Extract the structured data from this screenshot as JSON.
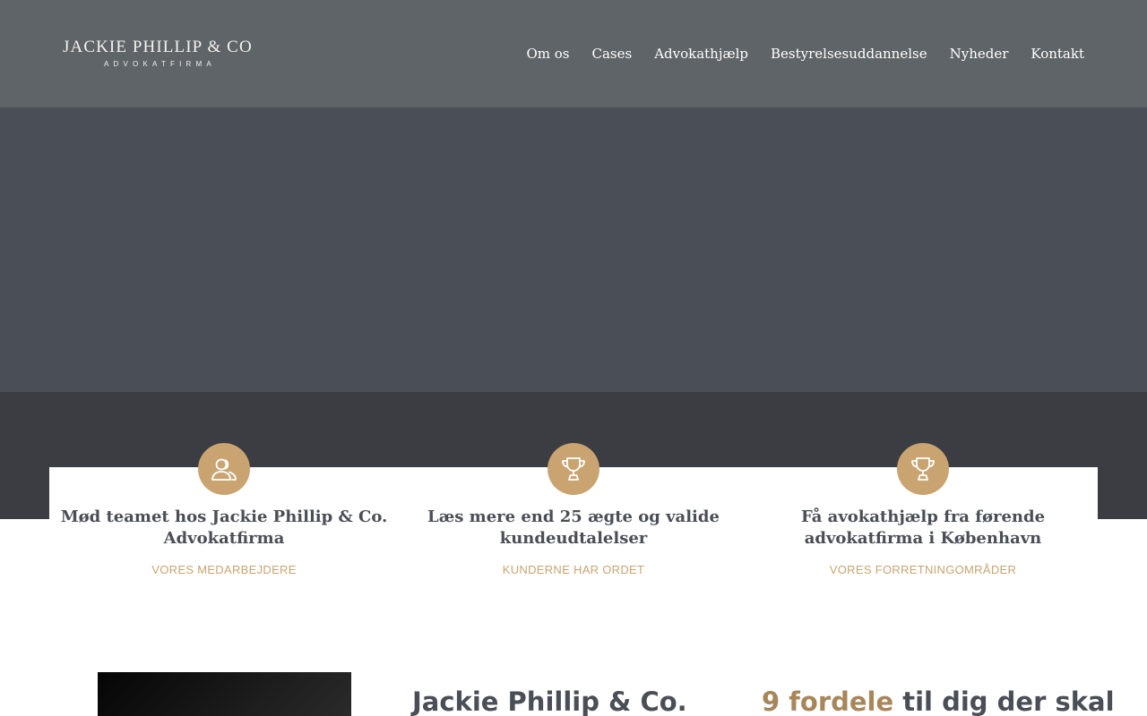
{
  "header": {
    "logo_name": "JACKIE PHILLIP & CO",
    "logo_sub": "ADVOKATFIRMA",
    "nav": [
      "Om os",
      "Cases",
      "Advokathjælp",
      "Bestyrelsesuddannelse",
      "Nyheder",
      "Kontakt"
    ]
  },
  "features": [
    {
      "icon": "people-icon",
      "title": "Mød teamet hos Jackie Phillip & Co. Advokatfirma",
      "link": "VORES MEDARBEJDERE"
    },
    {
      "icon": "trophy-icon",
      "title": "Læs mere end 25 ægte og valide kundeudtalelser",
      "link": "KUNDERNE HAR ORDET"
    },
    {
      "icon": "trophy-icon",
      "title": "Få avokathjælp fra førende advokatfirma i København",
      "link": "VORES FORRETNINGOMRÅDER"
    }
  ],
  "bottom": {
    "heading_left": "Jackie Phillip & Co.",
    "heading_right_accent": "9 fordele",
    "heading_right_rest": " til dig der skal"
  },
  "colors": {
    "header_bg": "#5f6468",
    "hero_bg": "#4a4e56",
    "band_bg": "#3b3d42",
    "accent_gold": "#c9a471",
    "text_dark": "#4a4e56"
  }
}
